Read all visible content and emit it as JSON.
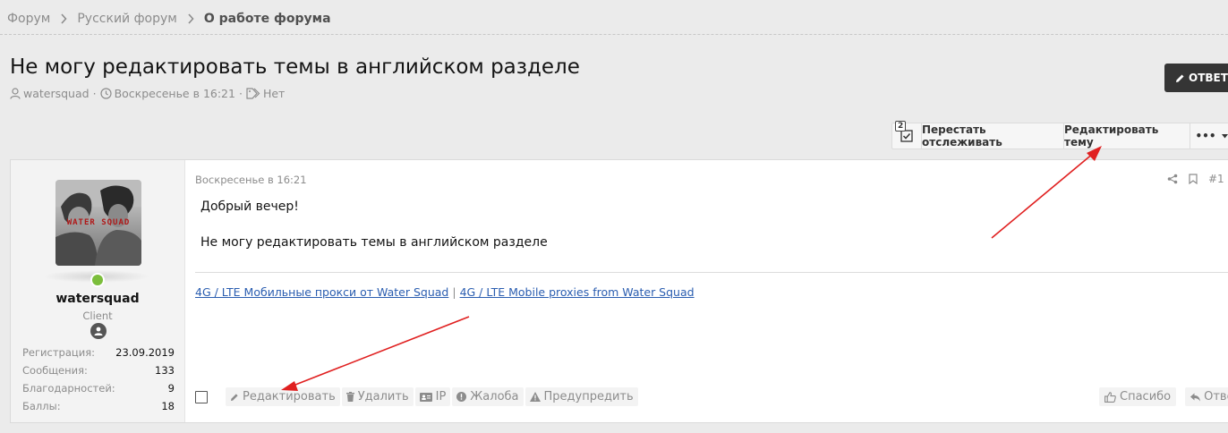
{
  "breadcrumb": {
    "items": [
      "Форум",
      "Русский форум"
    ],
    "current": "О работе форума"
  },
  "thread": {
    "title": "Не могу редактировать темы в английском разделе",
    "author": "watersquad",
    "date": "Воскресенье в 16:21",
    "tags": "Нет"
  },
  "reply_button": {
    "label": "ОТВЕТ"
  },
  "toolbar": {
    "badge": "2",
    "unwatch_label": "Перестать отслеживать",
    "edit_label": "Редактировать тему",
    "more_label": "•••"
  },
  "post": {
    "date": "Воскресенье в 16:21",
    "number": "#1",
    "lines": [
      "Добрый вечер!",
      "Не могу редактировать темы в английском разделе"
    ],
    "signature": {
      "link1": "4G / LTE Мобильные прокси от Water Squad",
      "separator": "|",
      "link2": "4G / LTE Mobile proxies from Water Squad"
    }
  },
  "user": {
    "name": "watersquad",
    "role": "Client",
    "avatar_text": "WATER SQUAD",
    "stats": [
      {
        "label": "Регистрация:",
        "value": "23.09.2019"
      },
      {
        "label": "Сообщения:",
        "value": "133"
      },
      {
        "label": "Благодарностей:",
        "value": "9"
      },
      {
        "label": "Баллы:",
        "value": "18"
      }
    ]
  },
  "actions": {
    "edit": "Редактировать",
    "delete": "Удалить",
    "ip": "IP",
    "report": "Жалоба",
    "warn": "Предупредить",
    "like": "Спасибо",
    "reply": "Ответ"
  },
  "colors": {
    "background": "#ebebeb",
    "link": "#2a5db0",
    "reply_button": "#353535",
    "online": "#7cbe3c",
    "annotation_arrow": "#e02020"
  }
}
